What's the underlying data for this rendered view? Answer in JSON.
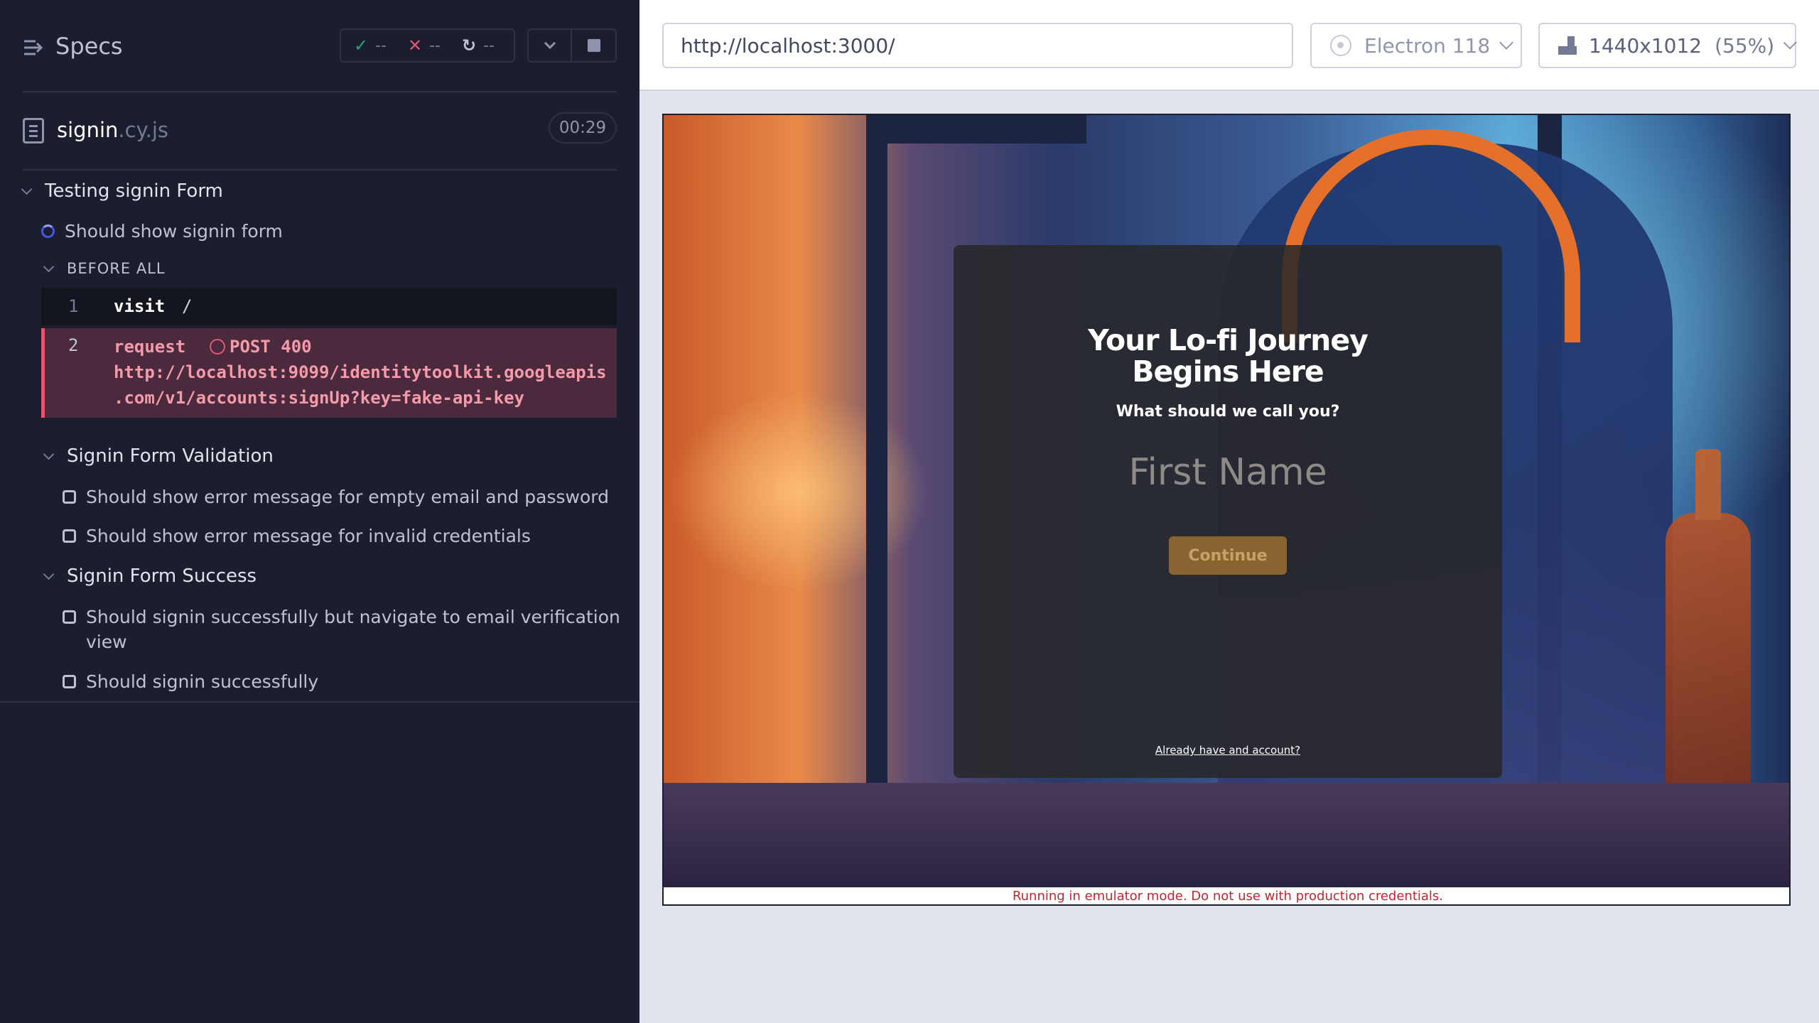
{
  "reporter": {
    "specs_label": "Specs",
    "stats": {
      "passed": "--",
      "failed": "--",
      "pending": "--"
    },
    "spec_file": {
      "name": "signin",
      "ext": ".cy.js",
      "duration": "00:29"
    },
    "suite": {
      "title": "Testing signin Form",
      "running_test": "Should show signin form",
      "hook_label": "BEFORE ALL",
      "commands": [
        {
          "num": "1",
          "name": "visit",
          "message": "/"
        },
        {
          "num": "2",
          "name": "request",
          "message": "POST 400",
          "url_line1": "http://localhost:9099/identitytoolkit.googleapis",
          "url_line2": ".com/v1/accounts:signUp?key=fake-api-key"
        }
      ]
    },
    "validation_suite": {
      "title": "Signin Form Validation",
      "tests": [
        "Should show error message for empty email and password",
        "Should show error message for invalid credentials"
      ]
    },
    "success_suite": {
      "title": "Signin Form Success",
      "tests": [
        "Should signin successfully but navigate to email verification",
        "view",
        "Should signin successfully"
      ]
    }
  },
  "aut": {
    "url": "http://localhost:3000/",
    "browser": "Electron 118",
    "viewport": "1440x1012",
    "scale": "(55%)"
  },
  "app": {
    "title_line1": "Your Lo-fi Journey",
    "title_line2": "Begins Here",
    "subtitle": "What should we call you?",
    "name_placeholder": "First Name",
    "continue_label": "Continue",
    "account_link": "Already have and account?",
    "emulator_notice": "Running in emulator mode. Do not use with production credentials."
  },
  "colors": {
    "reporter_bg": "#1b1e2e",
    "pass": "#1fa971",
    "fail": "#e45770",
    "running": "#4956e3",
    "continue_btn": "#8a6430",
    "notice_text": "#c0272d"
  },
  "icons": [
    "specs-toggle-icon",
    "check-icon",
    "x-icon",
    "spinner-icon",
    "chevron-down-icon",
    "stop-icon",
    "file-icon",
    "electron-icon",
    "ruler-icon"
  ]
}
